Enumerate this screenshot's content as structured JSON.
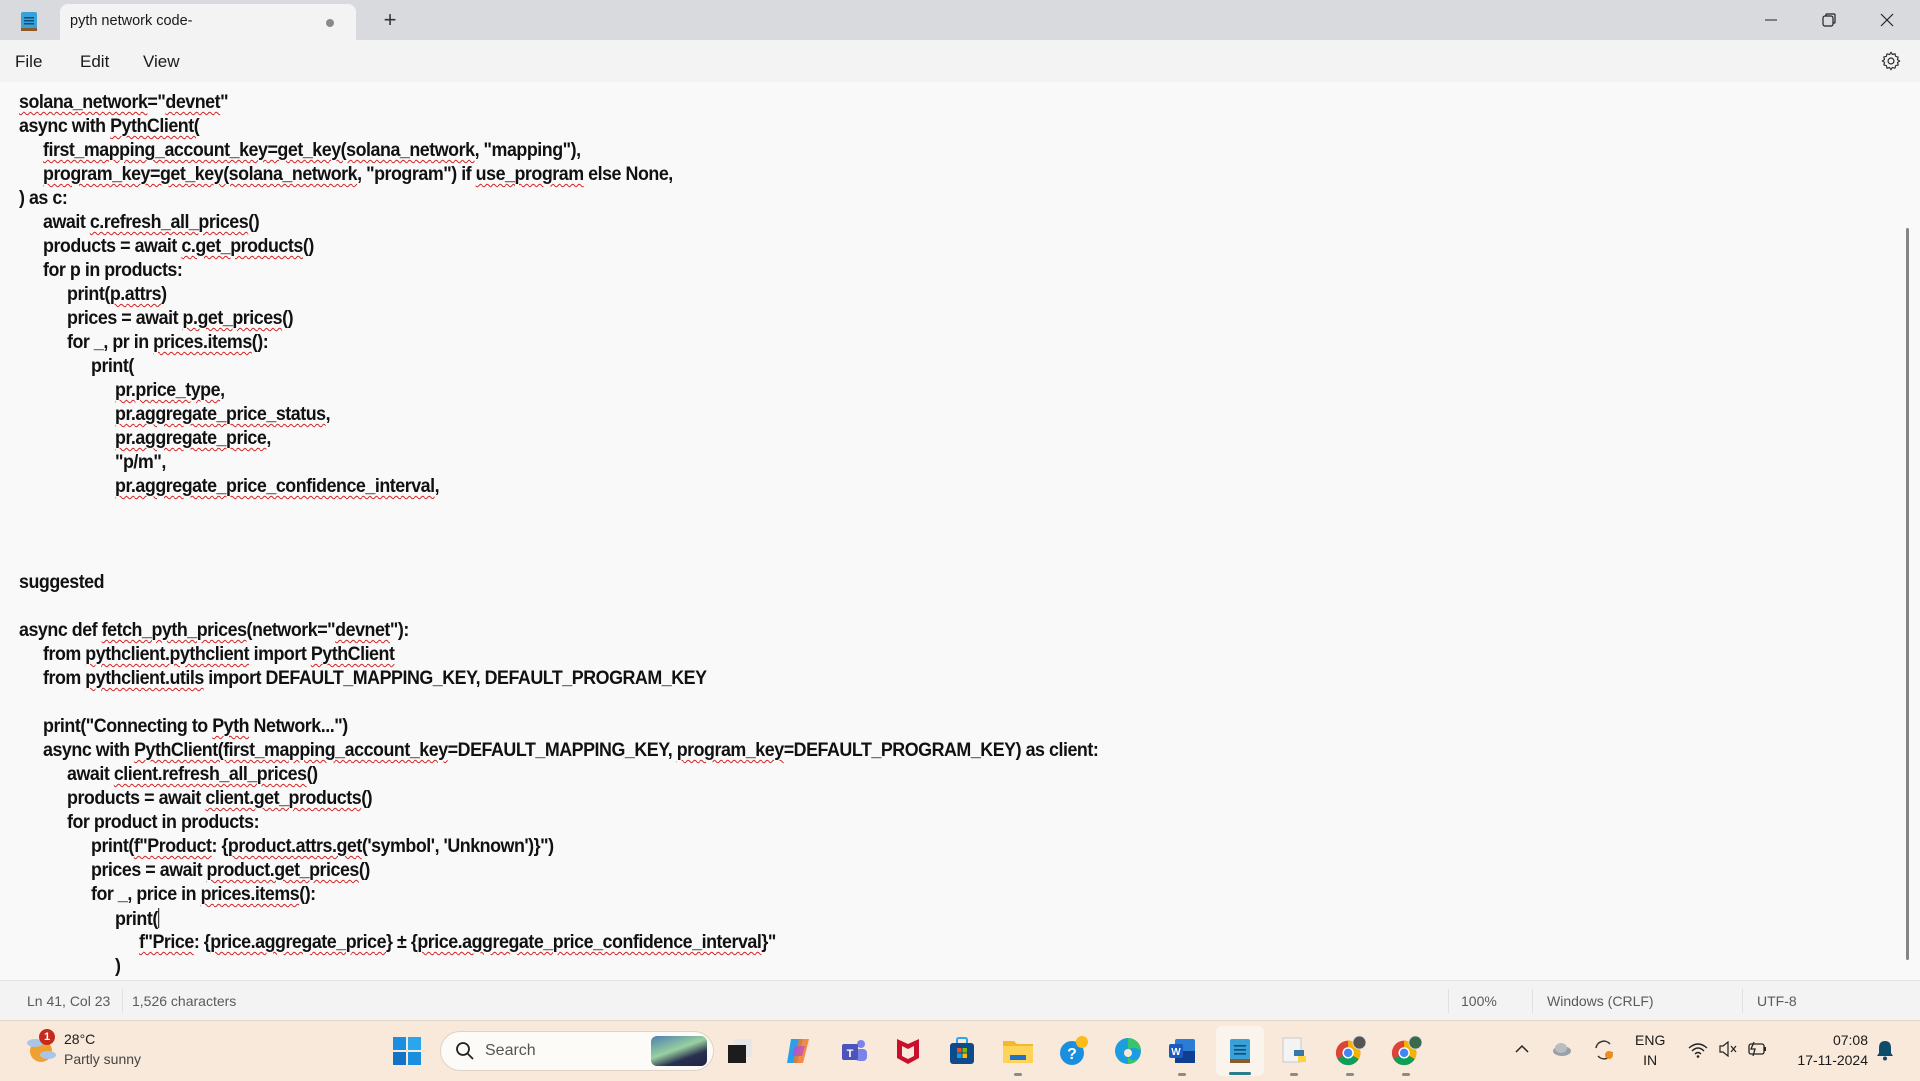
{
  "window": {
    "tab_title": "pyth network code-",
    "tab_unsaved": true,
    "new_tab_label": "+",
    "controls": [
      "minimize",
      "restore",
      "close"
    ]
  },
  "menu": {
    "items": [
      "File",
      "Edit",
      "View"
    ],
    "settings_icon": "gear-icon"
  },
  "editor": {
    "lines": [
      {
        "indent": 0,
        "segments": [
          {
            "t": "solana_network",
            "sq": true
          },
          {
            "t": "=\""
          },
          {
            "t": "devnet",
            "sq": true
          },
          {
            "t": "\""
          }
        ]
      },
      {
        "indent": 0,
        "segments": [
          {
            "t": "async with "
          },
          {
            "t": "PythClient(",
            "sq": true
          }
        ]
      },
      {
        "indent": 1,
        "segments": [
          {
            "t": "first_mapping_account_key=get_key(solana_network",
            "sq": true
          },
          {
            "t": ", \"mapping\"),"
          }
        ]
      },
      {
        "indent": 1,
        "segments": [
          {
            "t": "program_key=get_key(solana_network",
            "sq": true
          },
          {
            "t": ", \"program\") if "
          },
          {
            "t": "use_program",
            "sq": true
          },
          {
            "t": " else None,"
          }
        ]
      },
      {
        "indent": 0,
        "segments": [
          {
            "t": ") as c:"
          }
        ]
      },
      {
        "indent": 1,
        "segments": [
          {
            "t": "await "
          },
          {
            "t": "c.refresh_all_prices",
            "sq": true
          },
          {
            "t": "()"
          }
        ]
      },
      {
        "indent": 1,
        "segments": [
          {
            "t": "products = await "
          },
          {
            "t": "c.get_products",
            "sq": true
          },
          {
            "t": "()"
          }
        ]
      },
      {
        "indent": 1,
        "segments": [
          {
            "t": "for p in products:"
          }
        ]
      },
      {
        "indent": 2,
        "segments": [
          {
            "t": "print("
          },
          {
            "t": "p.attrs",
            "sq": true
          },
          {
            "t": ")"
          }
        ]
      },
      {
        "indent": 2,
        "segments": [
          {
            "t": "prices = await "
          },
          {
            "t": "p.get_prices",
            "sq": true
          },
          {
            "t": "()"
          }
        ]
      },
      {
        "indent": 2,
        "segments": [
          {
            "t": "for _, pr in "
          },
          {
            "t": "prices.items",
            "sq": true
          },
          {
            "t": "():"
          }
        ]
      },
      {
        "indent": 3,
        "segments": [
          {
            "t": "print("
          }
        ]
      },
      {
        "indent": 4,
        "segments": [
          {
            "t": "pr.price_type",
            "sq": true
          },
          {
            "t": ","
          }
        ]
      },
      {
        "indent": 4,
        "segments": [
          {
            "t": "pr.aggregate_price_status",
            "sq": true
          },
          {
            "t": ","
          }
        ]
      },
      {
        "indent": 4,
        "segments": [
          {
            "t": "pr.aggregate_price",
            "sq": true
          },
          {
            "t": ","
          }
        ]
      },
      {
        "indent": 4,
        "segments": [
          {
            "t": "\"p/m\","
          }
        ]
      },
      {
        "indent": 4,
        "segments": [
          {
            "t": "pr.aggregate_price_confidence_interval",
            "sq": true
          },
          {
            "t": ","
          }
        ]
      },
      {
        "indent": 0,
        "segments": []
      },
      {
        "indent": 0,
        "segments": []
      },
      {
        "indent": 0,
        "segments": []
      },
      {
        "indent": 0,
        "segments": [
          {
            "t": "suggested"
          }
        ]
      },
      {
        "indent": 0,
        "segments": []
      },
      {
        "indent": 0,
        "segments": [
          {
            "t": "async def "
          },
          {
            "t": "fetch_pyth_prices",
            "sq": true
          },
          {
            "t": "(network=\""
          },
          {
            "t": "devnet",
            "sq": true
          },
          {
            "t": "\"):"
          }
        ]
      },
      {
        "indent": 1,
        "segments": [
          {
            "t": "from "
          },
          {
            "t": "pythclient.pythclient",
            "sq": true
          },
          {
            "t": " import "
          },
          {
            "t": "PythClient",
            "sq": true
          }
        ]
      },
      {
        "indent": 1,
        "segments": [
          {
            "t": "from "
          },
          {
            "t": "pythclient.utils",
            "sq": true
          },
          {
            "t": " import DEFAULT_MAPPING_KEY, DEFAULT_PROGRAM_KEY"
          }
        ]
      },
      {
        "indent": 0,
        "segments": []
      },
      {
        "indent": 1,
        "segments": [
          {
            "t": "print(\"Connecting to "
          },
          {
            "t": "Pyth",
            "sq": true
          },
          {
            "t": " Network...\")"
          }
        ]
      },
      {
        "indent": 1,
        "segments": [
          {
            "t": "async with "
          },
          {
            "t": "PythClient(first_mapping_account_key",
            "sq": true
          },
          {
            "t": "=DEFAULT_MAPPING_KEY, "
          },
          {
            "t": "program_key",
            "sq": true
          },
          {
            "t": "=DEFAULT_PROGRAM_KEY) as client:"
          }
        ]
      },
      {
        "indent": 2,
        "segments": [
          {
            "t": "await "
          },
          {
            "t": "client.refresh_all_prices",
            "sq": true
          },
          {
            "t": "()"
          }
        ]
      },
      {
        "indent": 2,
        "segments": [
          {
            "t": "products = await "
          },
          {
            "t": "client.get_products",
            "sq": true
          },
          {
            "t": "()"
          }
        ]
      },
      {
        "indent": 2,
        "segments": [
          {
            "t": "for product in products:"
          }
        ]
      },
      {
        "indent": 3,
        "segments": [
          {
            "t": "print("
          },
          {
            "t": "f\"Product",
            "sq": true
          },
          {
            "t": ": {"
          },
          {
            "t": "product.attrs.get",
            "sq": true
          },
          {
            "t": "('symbol', 'Unknown')}\")"
          }
        ]
      },
      {
        "indent": 3,
        "segments": [
          {
            "t": "prices = await "
          },
          {
            "t": "product.get_prices",
            "sq": true
          },
          {
            "t": "()"
          }
        ]
      },
      {
        "indent": 3,
        "segments": [
          {
            "t": "for _, price in "
          },
          {
            "t": "prices.items",
            "sq": true
          },
          {
            "t": "():"
          }
        ]
      },
      {
        "indent": 4,
        "segments": [
          {
            "t": "print("
          },
          {
            "caret": true
          }
        ]
      },
      {
        "indent": 5,
        "segments": [
          {
            "t": "f\"Price",
            "sq": true
          },
          {
            "t": ": {"
          },
          {
            "t": "price.aggregate_price",
            "sq": true
          },
          {
            "t": "} ± {"
          },
          {
            "t": "price.aggregate_price_confidence_interval",
            "sq": true
          },
          {
            "t": "}\""
          }
        ]
      },
      {
        "indent": 4,
        "segments": [
          {
            "t": ")"
          }
        ]
      }
    ]
  },
  "status": {
    "position": "Ln 41, Col 23",
    "characters": "1,526 characters",
    "zoom": "100%",
    "line_ending": "Windows (CRLF)",
    "encoding": "UTF-8"
  },
  "taskbar": {
    "weather": {
      "temp": "28°C",
      "desc": "Partly sunny",
      "badge": "1"
    },
    "search_label": "Search",
    "apps": [
      "task-view",
      "copilot",
      "teams",
      "mcafee",
      "microsoft-store",
      "file-explorer",
      "get-help",
      "edge",
      "word",
      "notepad",
      "python-file",
      "chrome-profile-1",
      "chrome-profile-2"
    ],
    "tray": {
      "lang_top": "ENG",
      "lang_bottom": "IN",
      "time": "07:08",
      "date": "17-11-2024"
    }
  }
}
